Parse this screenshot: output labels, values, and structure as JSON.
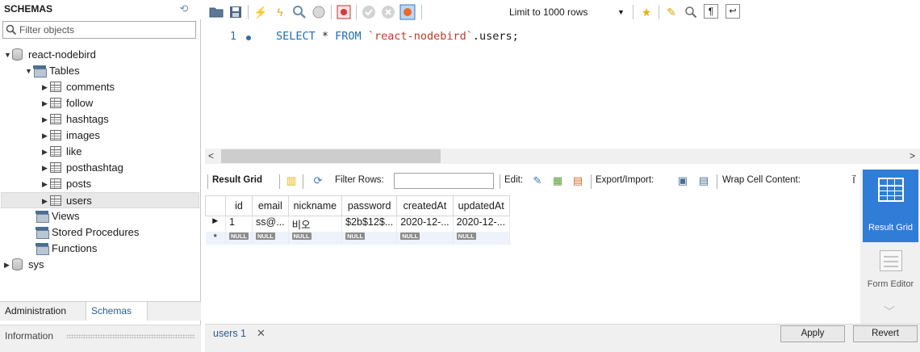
{
  "navigator": {
    "title": "SCHEMAS",
    "filter_placeholder": "Filter objects",
    "tree": {
      "schema1": "react-nodebird",
      "tables_folder": "Tables",
      "tables": [
        "comments",
        "follow",
        "hashtags",
        "images",
        "like",
        "posthashtag",
        "posts",
        "users"
      ],
      "selected_table": "users",
      "views_folder": "Views",
      "procedures_folder": "Stored Procedures",
      "functions_folder": "Functions",
      "schema2": "sys"
    },
    "tabs": {
      "administration": "Administration",
      "schemas": "Schemas"
    },
    "info_label": "Information"
  },
  "toolbar": {
    "limit_label": "Limit to 1000 rows",
    "icons": [
      "open-folder-icon",
      "save-icon",
      "execute-icon",
      "execute-current-icon",
      "explain-icon",
      "stop-icon",
      "toggle-error-icon",
      "commit-icon",
      "rollback-icon",
      "autocommit-icon",
      "bookmark-icon",
      "beautify-icon",
      "find-icon",
      "invisible-chars-icon",
      "wrap-icon"
    ]
  },
  "editor": {
    "line_number": "1",
    "sql": {
      "kw_select": "SELECT",
      "star": " * ",
      "kw_from": "FROM",
      "space": " ",
      "schema": "`react-nodebird`",
      "rest": ".users;"
    }
  },
  "result_toolbar": {
    "result_grid": "Result Grid",
    "filter_rows": "Filter Rows:",
    "edit": "Edit:",
    "export_import": "Export/Import:",
    "wrap_cell": "Wrap Cell Content:"
  },
  "grid": {
    "columns": [
      "id",
      "email",
      "nickname",
      "password",
      "createdAt",
      "updatedAt"
    ],
    "row": [
      "1",
      "ss@...",
      "비오",
      "$2b$12$...",
      "2020-12-...",
      "2020-12-..."
    ],
    "null_label": "NULL",
    "row_marker": "▶",
    "new_marker": "*"
  },
  "side_panel": {
    "result_grid": "Result Grid",
    "form_editor": "Form Editor"
  },
  "bottom": {
    "tab_label": "users 1",
    "apply": "Apply",
    "revert": "Revert"
  },
  "colors": {
    "accent": "#2f7dd6",
    "keyword": "#1f6fb2",
    "string": "#c0392b"
  }
}
